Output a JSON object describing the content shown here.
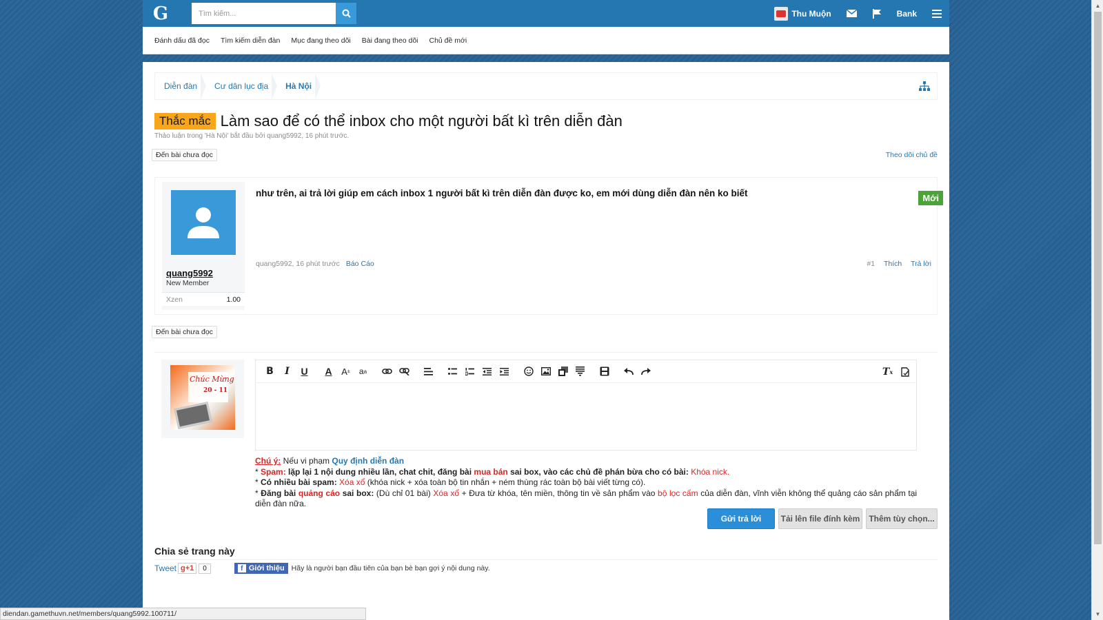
{
  "header": {
    "logo": "G",
    "search_placeholder": "Tìm kiếm...",
    "user_name": "Thu Muộn",
    "bank_label": "Bank"
  },
  "subnav": [
    "Đánh dấu đã đọc",
    "Tìm kiếm diễn đàn",
    "Mục đang theo dõi",
    "Bài đang theo dõi",
    "Chủ đề mới"
  ],
  "breadcrumb": [
    "Diễn đàn",
    "Cư dân lục địa",
    "Hà Nội"
  ],
  "thread": {
    "prefix": "Thắc mắc",
    "title": "Làm sao để có thể inbox cho một người bất kì trên diễn đàn",
    "meta": "Thảo luận trong 'Hà Nội' bắt đầu bởi quang5992, 16 phút trước.",
    "unread_button": "Đến bài chưa đọc",
    "follow_link": "Theo dõi chủ đề"
  },
  "post": {
    "username": "quang5992",
    "user_title": "New Member",
    "xzen_label": "Xzen",
    "xzen_value": "1.00",
    "text": "như trên, ai trả lời giúp em cách inbox 1 người bất kì trên diễn đàn được ko, em mới dùng diễn đàn nên ko biết",
    "new_badge": "Mới",
    "author_time": "quang5992, 16 phút trước",
    "report": "Báo Cáo",
    "number": "#1",
    "like": "Thích",
    "reply": "Trả lời"
  },
  "reply_avatar": {
    "line1": "Chúc Mừng",
    "line2": "20 - 11"
  },
  "notice": {
    "label": "Chú ý:",
    "intro": " Nếu vi phạm ",
    "rules_link": "Quy định diễn đàn",
    "line1_star": "* ",
    "line1_spam": "Spam:",
    "line1_a": " lặp lại 1 nội dung nhiều lần, chat chit, đăng bài ",
    "line1_sell": "mua bán",
    "line1_b": " sai box, vào các chủ đề phán bừa cho có bài: ",
    "line1_lock": "Khóa nick.",
    "line2_star": "* ",
    "line2_label": "Có nhiều bài spam:",
    "line2_del": " Xóa xổ",
    "line2_rest": " (khóa nick + xóa toàn bộ tin nhắn + ném thùng rác toàn bộ bài viết từng có).",
    "line3_star": "* ",
    "line3_a": "Đăng bài ",
    "line3_ad": "quảng cáo",
    "line3_b": " sai box:",
    "line3_c": " (Dù chỉ 01 bài) ",
    "line3_del": "Xóa xổ",
    "line3_d": " + Đưa từ khóa, tên miền, thông tin về sản phẩm vào ",
    "line3_filter": "bộ lọc cấm",
    "line3_e": " của diễn đàn, vĩnh viễn không thể quảng cáo sản phẩm tại diễn đàn nữa."
  },
  "buttons": {
    "submit": "Gửi trả lời",
    "upload": "Tải lên file đính kèm",
    "more": "Thêm tùy chọn..."
  },
  "share": {
    "title": "Chia sẻ trang này",
    "tweet": "Tweet",
    "gplus": "g+1",
    "gcount": "0",
    "fb_button": "Giới thiệu",
    "fb_text": "Hãy là người bạn đầu tiên của bạn bè bạn gợi ý nội dung này."
  },
  "statusbar": "diendan.gamethuvn.net/members/quang5992.100711/",
  "colors": {
    "header_bg": "#2577b1",
    "prefix_bg": "#f9a61b",
    "new_badge": "#4aa43a",
    "primary_button": "#2a8fd8"
  }
}
